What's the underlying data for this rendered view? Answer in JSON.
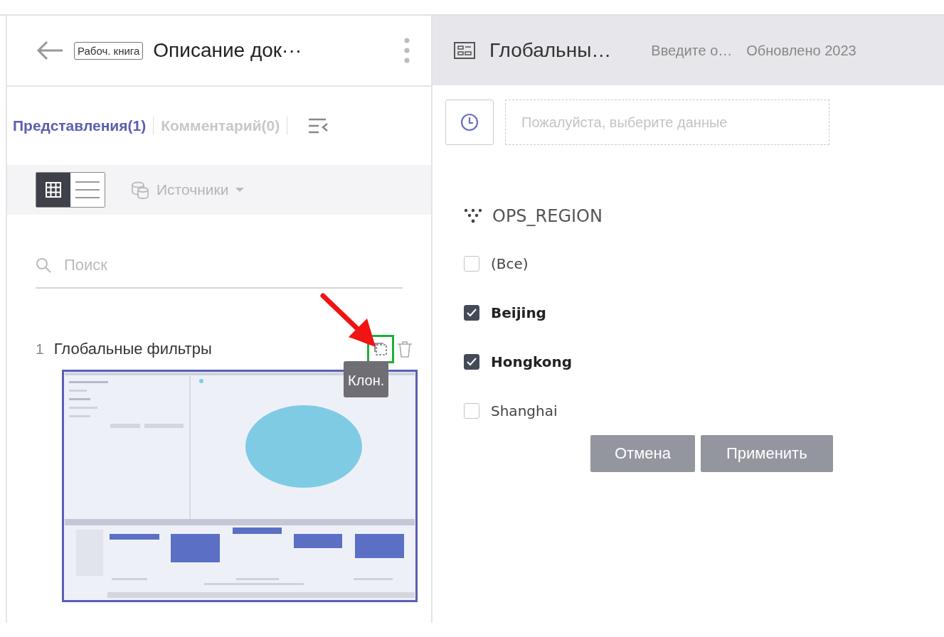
{
  "workbook": {
    "badge": "Рабоч. книга",
    "title": "Описание док···"
  },
  "tabs": [
    {
      "label": "Представления(1)",
      "selected": true
    },
    {
      "label": "Комментарий(0)",
      "selected": false
    }
  ],
  "view_toggle": [
    {
      "kind": "grid",
      "selected": true
    },
    {
      "kind": "list",
      "selected": false
    }
  ],
  "sources": {
    "label": "Источники"
  },
  "search": {
    "placeholder": "Поиск"
  },
  "views": [
    {
      "number": "1",
      "title": "Глобальные фильтры",
      "tooltip": "Клон."
    }
  ],
  "view_header": {
    "title": "Глобальны…",
    "description": "Введите о…",
    "updated": "Обновлено 2023"
  },
  "date_field": {
    "placeholder": "Пожалуйста, выберите данные"
  },
  "filter": {
    "title": "OPS_REGION",
    "options": [
      {
        "label": "(Все)",
        "checked": false
      },
      {
        "label": "Beijing",
        "checked": true
      },
      {
        "label": "Hongkong",
        "checked": true
      },
      {
        "label": "Shanghai",
        "checked": false
      }
    ]
  },
  "buttons": [
    "Отмена",
    "Применить"
  ]
}
